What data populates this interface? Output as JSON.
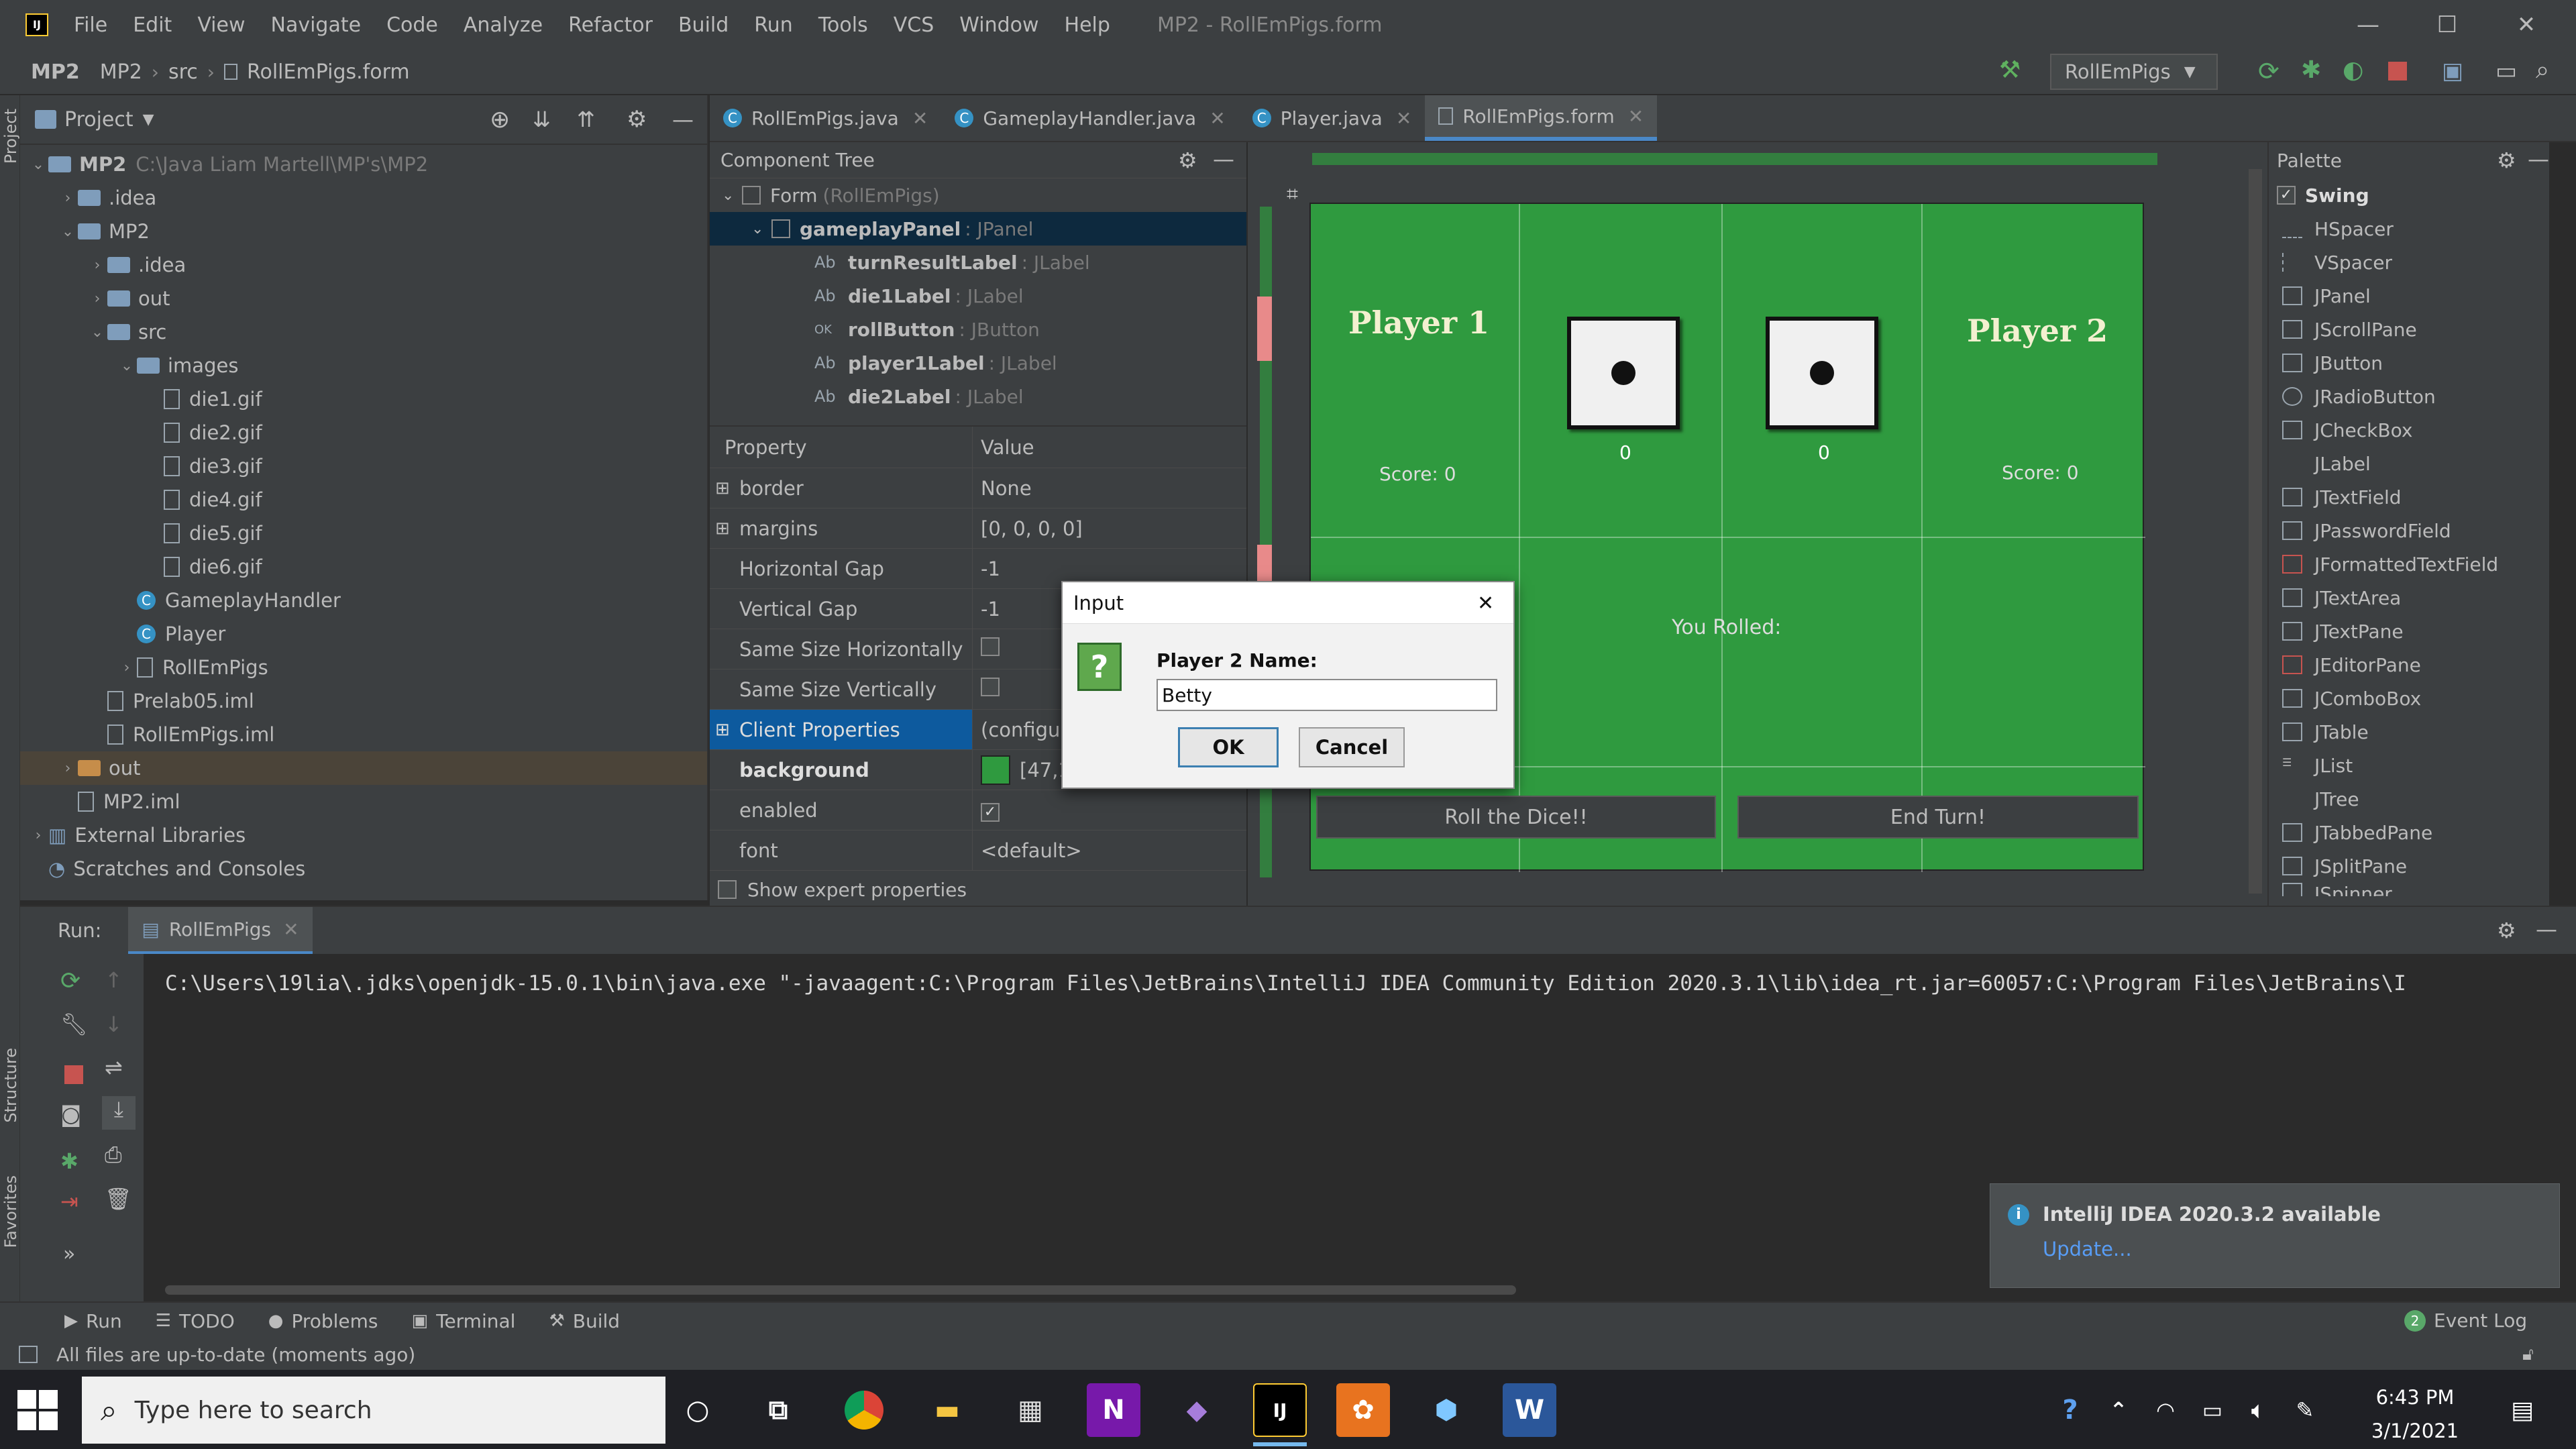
{
  "menu": {
    "items": [
      "File",
      "Edit",
      "View",
      "Navigate",
      "Code",
      "Analyze",
      "Refactor",
      "Build",
      "Run",
      "Tools",
      "VCS",
      "Window",
      "Help"
    ],
    "title": "MP2 - RollEmPigs.form"
  },
  "nav": {
    "crumbs": [
      "MP2",
      "MP2",
      "src",
      "RollEmPigs.form"
    ],
    "run_config": "RollEmPigs"
  },
  "tabs": [
    "RollEmPigs.java",
    "GameplayHandler.java",
    "Player.java",
    "RollEmPigs.form"
  ],
  "project": {
    "title": "Project",
    "root_name": "MP2",
    "root_path": "C:\\Java Liam Martell\\MP's\\MP2",
    "items": [
      {
        "label": ".idea"
      },
      {
        "label": "MP2"
      },
      {
        "label": ".idea"
      },
      {
        "label": "out"
      },
      {
        "label": "src"
      },
      {
        "label": "images"
      },
      {
        "label": "die1.gif"
      },
      {
        "label": "die2.gif"
      },
      {
        "label": "die3.gif"
      },
      {
        "label": "die4.gif"
      },
      {
        "label": "die5.gif"
      },
      {
        "label": "die6.gif"
      },
      {
        "label": "GameplayHandler"
      },
      {
        "label": "Player"
      },
      {
        "label": "RollEmPigs"
      },
      {
        "label": "Prelab05.iml"
      },
      {
        "label": "RollEmPigs.iml"
      },
      {
        "label": "out"
      },
      {
        "label": "MP2.iml"
      },
      {
        "label": "External Libraries"
      },
      {
        "label": "Scratches and Consoles"
      }
    ]
  },
  "component_tree": {
    "title": "Component Tree",
    "form": "Form",
    "form_class": "(RollEmPigs)",
    "panel": "gameplayPanel",
    "panel_type": ": JPanel",
    "children": [
      {
        "name": "turnResultLabel",
        "type": ": JLabel",
        "icon": "Ab"
      },
      {
        "name": "die1Label",
        "type": ": JLabel",
        "icon": "Ab"
      },
      {
        "name": "rollButton",
        "type": ": JButton",
        "icon": "OK"
      },
      {
        "name": "player1Label",
        "type": ": JLabel",
        "icon": "Ab"
      },
      {
        "name": "die2Label",
        "type": ": JLabel",
        "icon": "Ab"
      }
    ]
  },
  "properties": {
    "header_property": "Property",
    "header_value": "Value",
    "rows": [
      {
        "name": "border",
        "value": "None"
      },
      {
        "name": "margins",
        "value": "[0, 0, 0, 0]"
      },
      {
        "name": "Horizontal Gap",
        "value": "-1"
      },
      {
        "name": "Vertical Gap",
        "value": "-1"
      },
      {
        "name": "Same Size Horizontally",
        "value": ""
      },
      {
        "name": "Same Size Vertically",
        "value": ""
      },
      {
        "name": "Client Properties",
        "value": "(configure"
      },
      {
        "name": "background",
        "value": "[47,1"
      },
      {
        "name": "enabled",
        "value": ""
      },
      {
        "name": "font",
        "value": "<default>"
      }
    ],
    "show_expert": "Show expert properties",
    "background_color": "#2f9a3f"
  },
  "form": {
    "player1": "Player 1",
    "player2": "Player 2",
    "score1": "Score: 0",
    "score2": "Score: 0",
    "die1_value": "0",
    "die2_value": "0",
    "you_rolled": "You Rolled:",
    "roll_button": "Roll the Dice!!",
    "end_button": "End Turn!"
  },
  "palette": {
    "title": "Palette",
    "group": "Swing",
    "items": [
      "HSpacer",
      "VSpacer",
      "JPanel",
      "JScrollPane",
      "JButton",
      "JRadioButton",
      "JCheckBox",
      "JLabel",
      "JTextField",
      "JPasswordField",
      "JFormattedTextField",
      "JTextArea",
      "JTextPane",
      "JEditorPane",
      "JComboBox",
      "JTable",
      "JList",
      "JTree",
      "JTabbedPane",
      "JSplitPane",
      "JSpinner"
    ]
  },
  "run": {
    "label": "Run:",
    "tab": "RollEmPigs",
    "command": "C:\\Users\\19lia\\.jdks\\openjdk-15.0.1\\bin\\java.exe \"-javaagent:C:\\Program Files\\JetBrains\\IntelliJ IDEA Community Edition 2020.3.1\\lib\\idea_rt.jar=60057:C:\\Program Files\\JetBrains\\I"
  },
  "dialog": {
    "title": "Input",
    "prompt": "Player 2 Name:",
    "value": "Betty",
    "ok": "OK",
    "cancel": "Cancel"
  },
  "notification": {
    "title": "IntelliJ IDEA 2020.3.2 available",
    "link": "Update..."
  },
  "toolwindows": [
    "Run",
    "TODO",
    "Problems",
    "Terminal",
    "Build"
  ],
  "event_log": "Event Log",
  "event_log_count": "2",
  "status": "All files are up-to-date (moments ago)",
  "sidebar_labels": [
    "Project",
    "Structure",
    "Favorites"
  ],
  "taskbar": {
    "search_placeholder": "Type here to search",
    "time": "6:43 PM",
    "date": "3/1/2021"
  }
}
